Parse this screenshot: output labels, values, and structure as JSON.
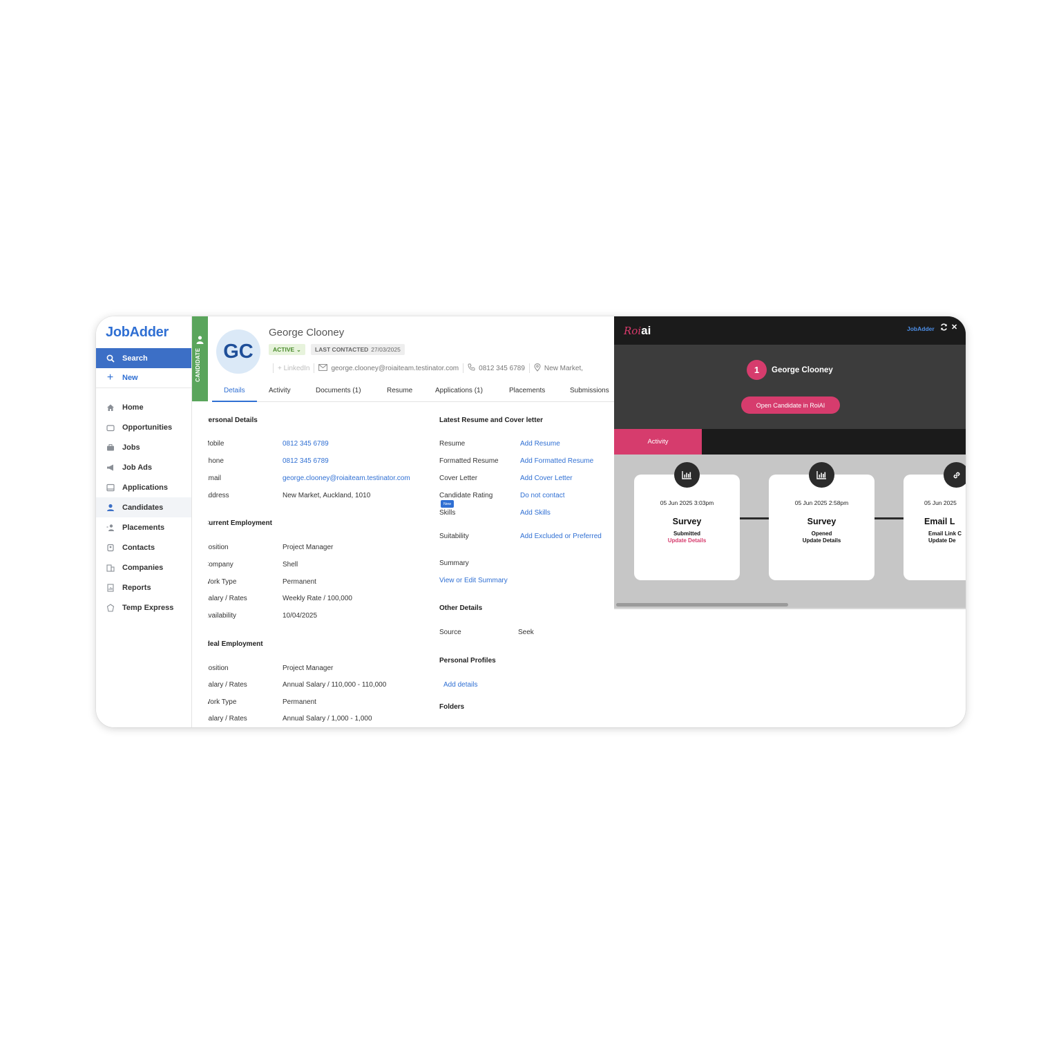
{
  "app": {
    "logo": "JobAdder"
  },
  "sidebar": {
    "search": "Search",
    "new": "New",
    "items": [
      {
        "label": "Home",
        "icon": "home-icon"
      },
      {
        "label": "Opportunities",
        "icon": "opportunities-icon"
      },
      {
        "label": "Jobs",
        "icon": "briefcase-icon"
      },
      {
        "label": "Job Ads",
        "icon": "megaphone-icon"
      },
      {
        "label": "Applications",
        "icon": "inbox-icon"
      },
      {
        "label": "Candidates",
        "icon": "person-icon"
      },
      {
        "label": "Placements",
        "icon": "placement-icon"
      },
      {
        "label": "Contacts",
        "icon": "contact-icon"
      },
      {
        "label": "Companies",
        "icon": "building-icon"
      },
      {
        "label": "Reports",
        "icon": "report-icon"
      },
      {
        "label": "Temp Express",
        "icon": "temp-icon"
      }
    ]
  },
  "candidate": {
    "strip_label": "CANDIDATE",
    "initials": "GC",
    "name": "George Clooney",
    "status": "ACTIVE",
    "last_contacted_label": "LAST CONTACTED",
    "last_contacted_date": "27/03/2025",
    "linkedin": "+ LinkedIn",
    "email": "george.clooney@roiaiteam.testinator.com",
    "phone": "0812 345 6789",
    "location": "New Market,"
  },
  "tabs": [
    "Details",
    "Activity",
    "Documents (1)",
    "Resume",
    "Applications (1)",
    "Placements",
    "Submissions"
  ],
  "personal": {
    "title": "Personal Details",
    "mobile_label": "Mobile",
    "mobile": "0812 345 6789",
    "phone_label": "Phone",
    "phone": "0812 345 6789",
    "email_label": "Email",
    "email": "george.clooney@roiaiteam.testinator.com",
    "address_label": "Address",
    "address": "New Market, Auckland, 1010"
  },
  "current": {
    "title": "Current Employment",
    "position_label": "Position",
    "position": "Project Manager",
    "company_label": "Company",
    "company": "Shell",
    "worktype_label": "Work Type",
    "worktype": "Permanent",
    "salary_label": "Salary / Rates",
    "salary": "Weekly Rate / 100,000",
    "availability_label": "Availability",
    "availability": "10/04/2025"
  },
  "ideal": {
    "title": "Ideal Employment",
    "position_label": "Position",
    "position": "Project Manager",
    "salary_label": "Salary / Rates",
    "salary": "Annual Salary / 110,000 - 110,000",
    "worktype_label": "Work Type",
    "worktype": "Permanent",
    "salary2_label": "Salary / Rates",
    "salary2": "Annual Salary / 1,000 - 1,000"
  },
  "resume": {
    "title": "Latest Resume and Cover letter",
    "resume_label": "Resume",
    "resume_link": "Add Resume",
    "formatted_label": "Formatted Resume",
    "formatted_link": "Add Formatted Resume",
    "cover_label": "Cover Letter",
    "cover_link": "Add Cover Letter",
    "rating_label": "Candidate Rating",
    "rating_link": "Do not contact",
    "new_badge": "New",
    "skills_label": "Skills",
    "skills_link": "Add Skills",
    "suitability_label": "Suitability",
    "suitability_link": "Add Excluded or Preferred",
    "summary_label": "Summary",
    "summary_link": "View or Edit Summary"
  },
  "other": {
    "title": "Other Details",
    "source_label": "Source",
    "source": "Seek",
    "profiles_title": "Personal Profiles",
    "profiles_link": "Add details",
    "folders_title": "Folders"
  },
  "roi": {
    "logo_a": "Roi",
    "logo_b": "ai",
    "jobadder": "JobAdder",
    "count": "1",
    "name": "George Clooney",
    "open_button": "Open Candidate in RoiAI",
    "tab": "Activity",
    "cards": [
      {
        "date": "05 Jun 2025 3:03pm",
        "title": "Survey",
        "status": "Submitted",
        "action": "Update Details",
        "icon": "bar-chart-icon"
      },
      {
        "date": "05 Jun 2025 2:58pm",
        "title": "Survey",
        "status": "Opened",
        "action": "Update Details",
        "icon": "bar-chart-icon"
      },
      {
        "date": "05 Jun 2025",
        "title": "Email L",
        "status": "Email Link C",
        "action": "Update De",
        "icon": "link-icon"
      }
    ]
  },
  "colors": {
    "brand_blue": "#2f6fd3",
    "candidate_green": "#5aa55c",
    "roi_pink": "#d63c6d"
  }
}
